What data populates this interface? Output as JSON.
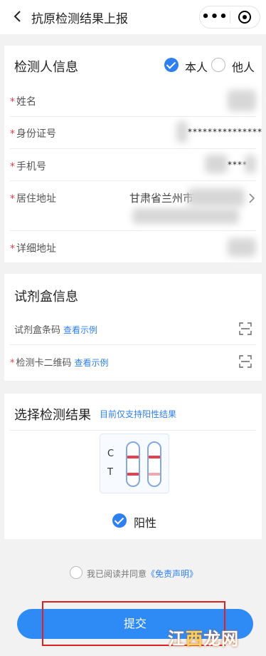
{
  "nav": {
    "title": "抗原检测结果上报",
    "menu_icon": "•••",
    "close_icon": "record-circle"
  },
  "tester": {
    "section_title": "检测人信息",
    "option_self": "本人",
    "option_other": "他人",
    "selected": "本人",
    "fields": {
      "name_label": "姓名",
      "id_label": "身份证号",
      "id_value": "***************",
      "phone_label": "手机号",
      "phone_value": "****",
      "address_label": "居住地址",
      "address_value": "甘肃省兰州市",
      "detail_label": "详细地址"
    }
  },
  "kit": {
    "section_title": "试剂盒信息",
    "barcode_label": "试剂盒条码",
    "barcode_link": "查看示例",
    "qrcode_label": "检测卡二维码",
    "qrcode_link": "查看示例"
  },
  "result": {
    "section_title": "选择检测结果",
    "note": "目前仅支持阳性结果",
    "c_label": "C",
    "t_label": "T",
    "option_label": "阳性",
    "band_color": "#e54050"
  },
  "consent": {
    "prefix": "我已阅读并同意",
    "link": "《免责声明》"
  },
  "submit_label": "提交",
  "watermark": {
    "part1": "江",
    "part2": "西",
    "part3": "龙网"
  },
  "colors": {
    "accent": "#2f7ff0",
    "required": "#e0404a"
  }
}
